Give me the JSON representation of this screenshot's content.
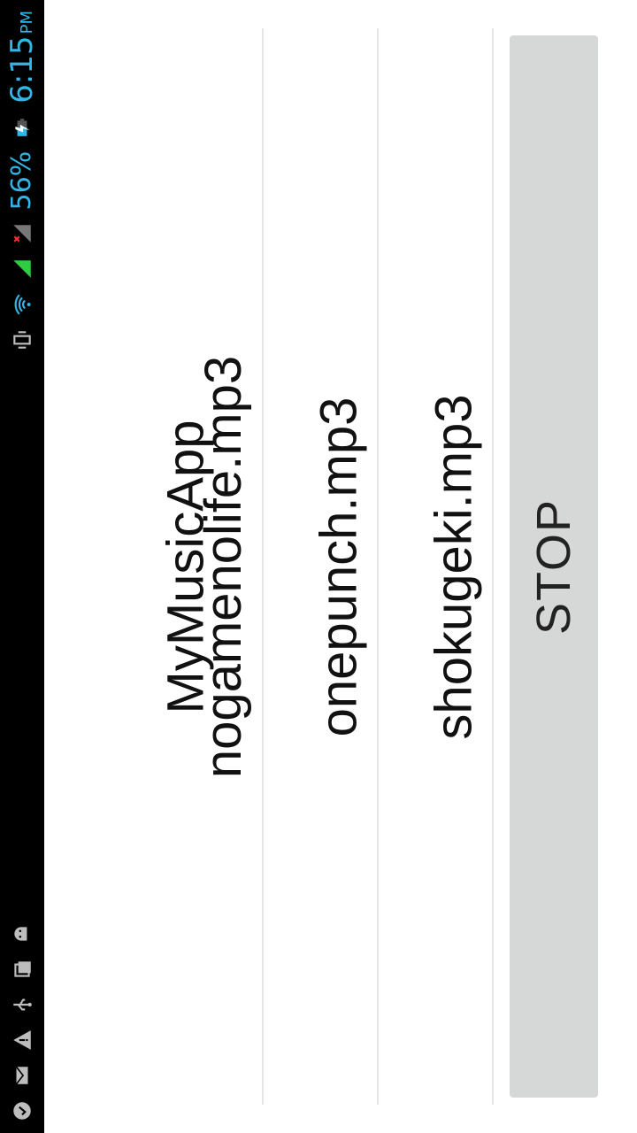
{
  "status_bar": {
    "battery_percent": "56%",
    "time": "6:15",
    "ampm": "PM",
    "icons_left": [
      "android-debug-icon",
      "screenshot-icon",
      "usb-icon",
      "warning-icon",
      "email-icon",
      "sync-icon"
    ],
    "icons_right": [
      "vibrate-icon",
      "wifi-icon",
      "signal-icon",
      "signal-no-icon",
      "battery-charging-icon"
    ],
    "accent": "#33b5e5"
  },
  "app": {
    "title": "MyMusicApp"
  },
  "songs": [
    {
      "label": "nogamenolife.mp3"
    },
    {
      "label": "onepunch.mp3"
    },
    {
      "label": "shokugeki.mp3"
    }
  ],
  "controls": {
    "stop_label": "STOP"
  }
}
